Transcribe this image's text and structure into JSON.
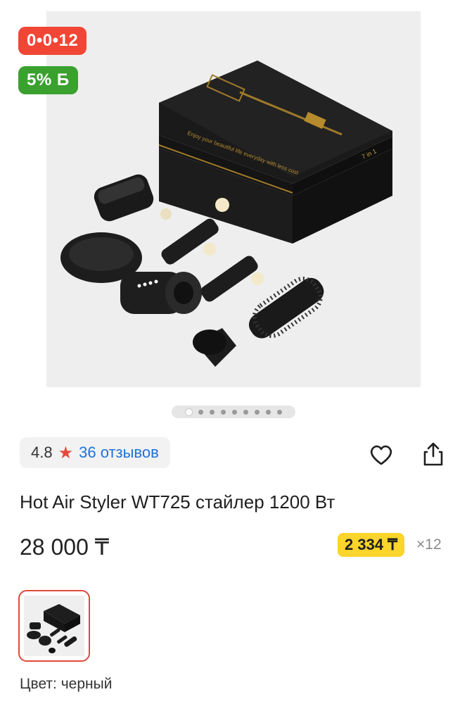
{
  "badges": {
    "timer": "0•0•12",
    "cashback": "5% Б"
  },
  "gallery": {
    "dot_count": 9,
    "active_index": 0,
    "box_text": "Enjoy your beautiful life everyday with less cost",
    "box_side_text": "7 in 1"
  },
  "rating": {
    "score": "4.8",
    "reviews": "36 отзывов"
  },
  "product": {
    "title": "Hot Air Styler WT725 стайлер 1200 Вт",
    "price": "28 000 ₸",
    "installment": "2 334 ₸",
    "multiplier": "×12"
  },
  "variant": {
    "color_label": "Цвет: черный"
  },
  "colors": {
    "timer_badge": "#f14635",
    "cashback_badge": "#3aa12f",
    "installment_badge": "#fbd42c",
    "reviews_link": "#1e72d8",
    "selected_border": "#e0493b"
  }
}
